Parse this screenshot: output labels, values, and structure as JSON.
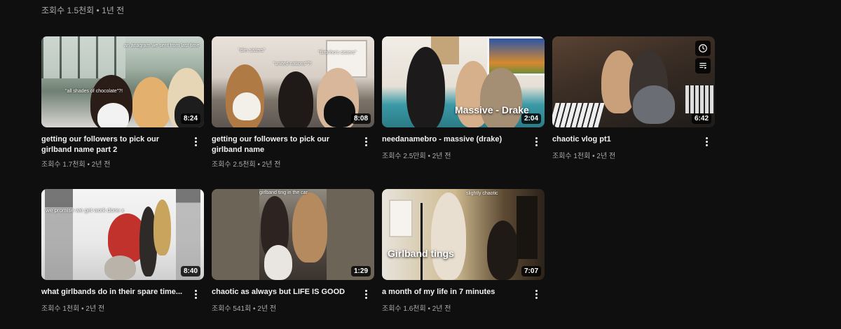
{
  "top_row": {
    "first_meta": "조회수 1.5천회 • 1년 전"
  },
  "videos": [
    {
      "title": "getting our followers to pick our girlband name part 2",
      "views": "조회수 1.7천회",
      "age": "2년 전",
      "duration": "8:24",
      "captions": [
        "an anagram we sent from last time",
        "\"all shades of chocolate\"?!"
      ]
    },
    {
      "title": "getting our followers to pick our girlband name",
      "views": "조회수 2.5천회",
      "age": "2년 전",
      "duration": "8:08",
      "captions": [
        "\"dim sisters\"",
        "\"united nations\"?!",
        "\"flirtinho's sisters\""
      ]
    },
    {
      "title": "needanamebro - massive (drake)",
      "views": "조회수 2.5만회",
      "age": "2년 전",
      "duration": "2:04",
      "overlay": "Massive - Drake"
    },
    {
      "title": "chaotic vlog pt1",
      "views": "조회수 1천회",
      "age": "2년 전",
      "duration": "6:42"
    },
    {
      "title": "what girlbands do in their spare time...",
      "views": "조회수 1천회",
      "age": "2년 전",
      "duration": "8:40",
      "captions": [
        "we promise we get work done x"
      ]
    },
    {
      "title": "chaotic as always but LIFE IS GOOD",
      "views": "조회수 541회",
      "age": "2년 전",
      "duration": "1:29",
      "captions": [
        "girlband ting in the car"
      ]
    },
    {
      "title": "a month of my life in 7 minutes",
      "views": "조회수 1.6천회",
      "age": "2년 전",
      "duration": "7:07",
      "captions": [
        "slightly chaotic"
      ],
      "overlay": "Girlband tings"
    }
  ],
  "separator": " • ",
  "icons": {
    "watch_later": "clock-icon",
    "add_to_queue": "queue-icon",
    "more": "more-vert-icon"
  }
}
